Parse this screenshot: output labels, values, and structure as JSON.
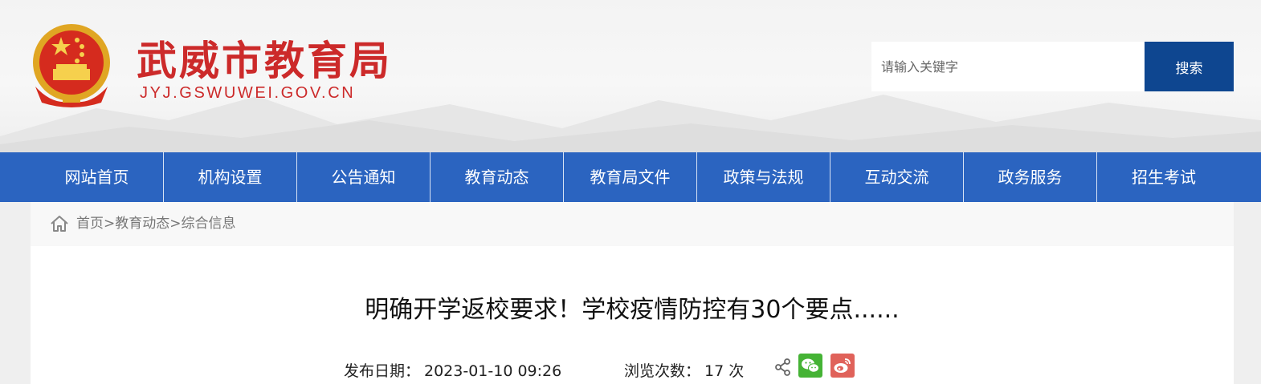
{
  "header": {
    "title": "武威市教育局",
    "domain": "JYJ.GSWUWEI.GOV.CN",
    "emblem_icon": "national-emblem-icon",
    "search": {
      "placeholder": "请输入关键字",
      "button_label": "搜索"
    }
  },
  "nav": {
    "items": [
      {
        "label": "网站首页"
      },
      {
        "label": "机构设置"
      },
      {
        "label": "公告通知"
      },
      {
        "label": "教育动态"
      },
      {
        "label": "教育局文件"
      },
      {
        "label": "政策与法规"
      },
      {
        "label": "互动交流"
      },
      {
        "label": "政务服务"
      },
      {
        "label": "招生考试"
      }
    ]
  },
  "breadcrumb": {
    "icon": "home-icon",
    "items": [
      "首页",
      "教育动态",
      "综合信息"
    ],
    "separator": ">"
  },
  "article": {
    "title": "明确开学返校要求！学校疫情防控有30个要点......",
    "publish_label": "发布日期：",
    "publish_date": "2023-01-10 09:26",
    "views_label": "浏览次数：",
    "views_count": "17 次",
    "share_icons": [
      "share-icon",
      "wechat-icon",
      "weibo-icon"
    ]
  },
  "colors": {
    "brand_red": "#cc2a2a",
    "nav_blue": "#2b64c0",
    "search_button_blue": "#0e4690",
    "wechat_green": "#45b335",
    "weibo_red": "#e0625a"
  }
}
